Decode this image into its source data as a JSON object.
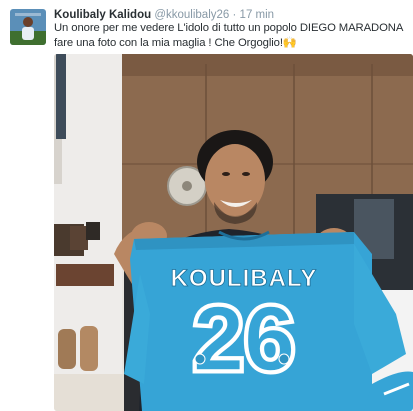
{
  "tweet": {
    "author_name": "Koulibaly Kalidou",
    "author_handle": "@kkoulibaly26",
    "separator": "·",
    "timestamp": "17 min",
    "text": "Un onore per me vedere L'idolo di tutto un popolo DIEGO MARADONA fare una foto con la mia maglia ! Che Orgoglio!🙌"
  },
  "media": {
    "jersey_name": "KOULIBALY",
    "jersey_number": "26",
    "colors": {
      "jersey_blue": "#36a4d6",
      "wall_brown": "#8c6a4f",
      "shirt_dark": "#1f242c",
      "skin": "#b98763"
    }
  }
}
